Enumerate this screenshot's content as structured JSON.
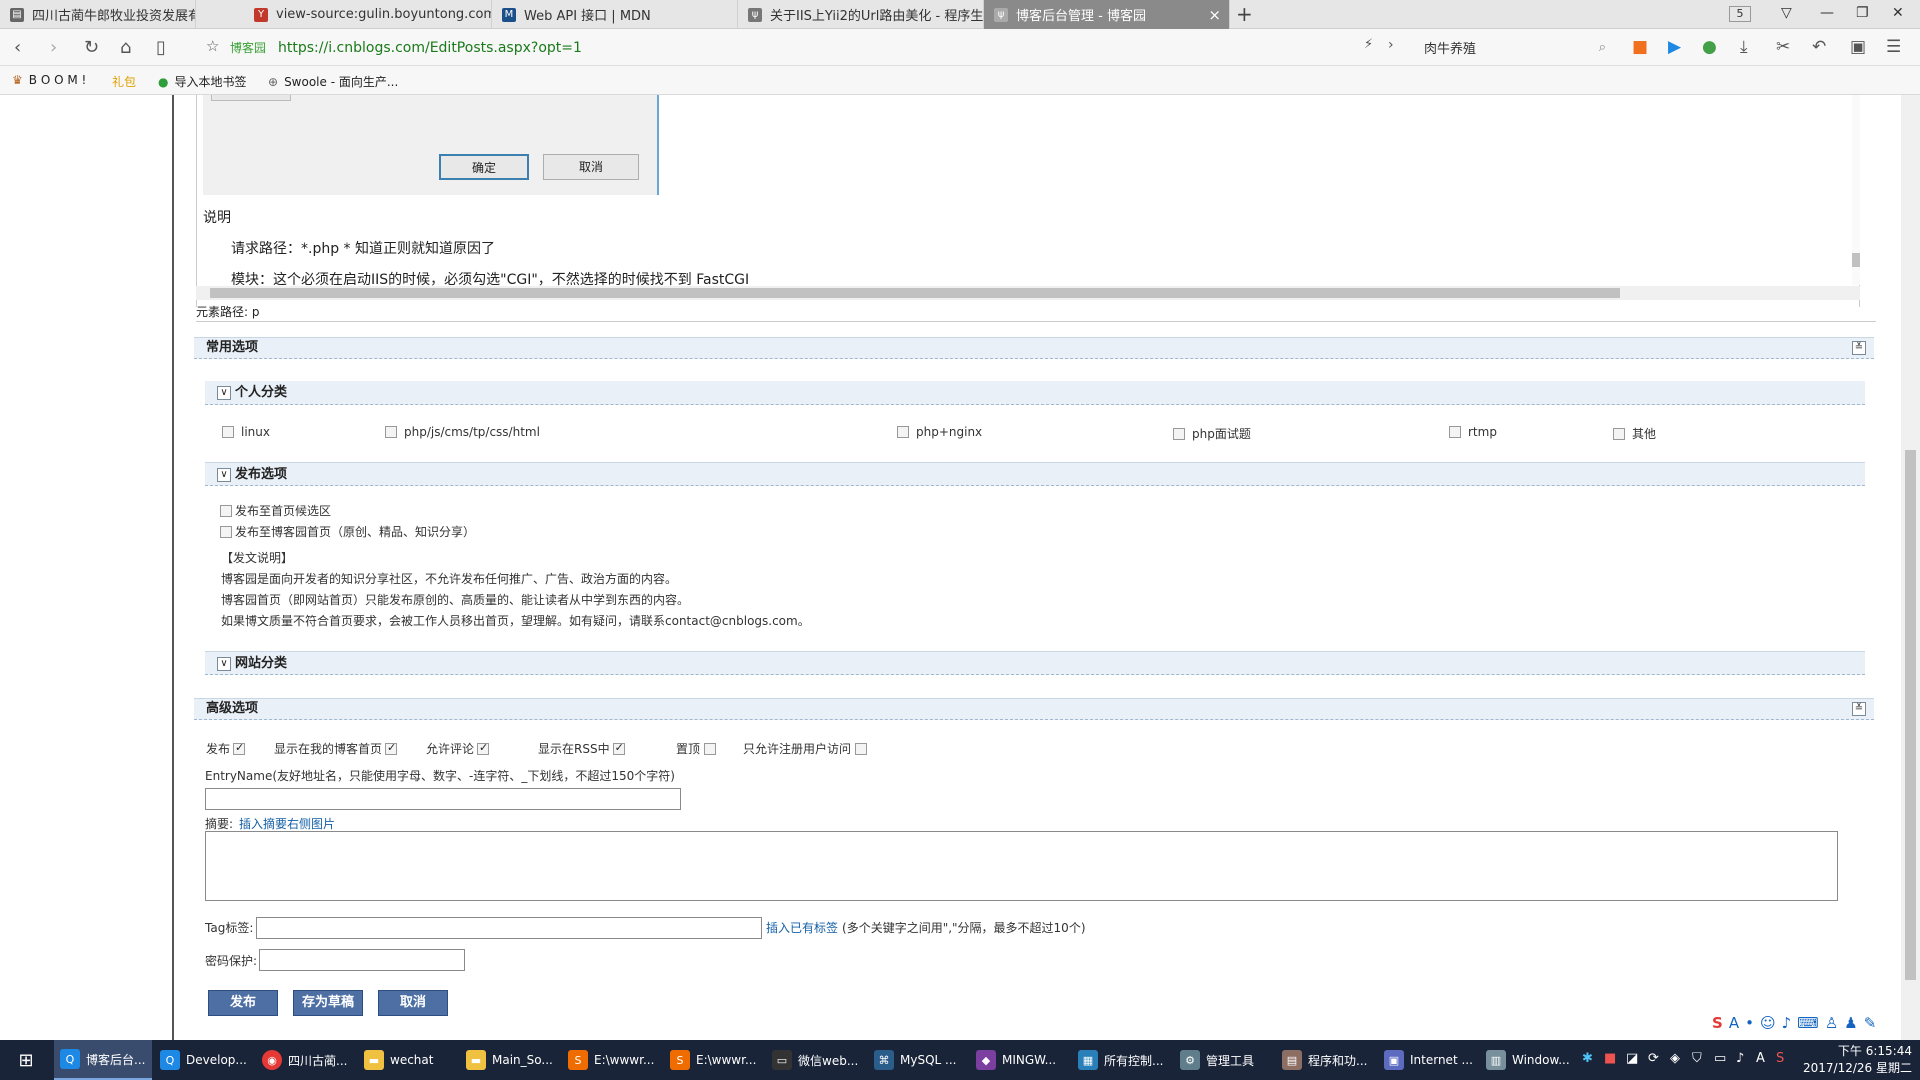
{
  "browser": {
    "tabs": [
      {
        "title": "四川古蔺牛郎牧业投资发展有限公司",
        "active": false
      },
      {
        "title": "view-source:gulin.boyuntong.com",
        "active": false
      },
      {
        "title": "Web API 接口 | MDN",
        "active": false
      },
      {
        "title": "关于IIS上Yii2的Url路由美化 - 程序生",
        "active": false
      },
      {
        "title": "博客后台管理 - 博客园",
        "active": true
      }
    ],
    "new_tab": "+",
    "tab_count": "5",
    "address": {
      "site_label": "博客园",
      "url": "https://i.cnblogs.com/EditPosts.aspx?opt=1"
    },
    "search": "肉牛养殖",
    "bookmarks": [
      "B O O M !",
      "礼包",
      "导入本地书签",
      "Swoole - 面向生产..."
    ]
  },
  "editor": {
    "dialog": {
      "ok": "确定",
      "cancel": "取消"
    },
    "lines": [
      "说明",
      "请求路径：*.php * 知道正则就知道原因了",
      "模块：这个必须在启动IIS的时候，必须勾选\"CGI\"，不然选择的时候找不到 FastCGI"
    ],
    "path": "元素路径: p"
  },
  "common": {
    "title": "常用选项",
    "personal": {
      "title": "个人分类",
      "categories": [
        "linux",
        "php/js/cms/tp/css/html",
        "php+nginx",
        "php面试题",
        "rtmp",
        "其他"
      ]
    },
    "publish": {
      "title": "发布选项",
      "options": [
        "发布至首页候选区",
        "发布至博客园首页（原创、精品、知识分享）"
      ],
      "notes": [
        "【发文说明】",
        "博客园是面向开发者的知识分享社区，不允许发布任何推广、广告、政治方面的内容。",
        "博客园首页（即网站首页）只能发布原创的、高质量的、能让读者从中学到东西的内容。",
        "如果博文质量不符合首页要求，会被工作人员移出首页，望理解。如有疑问，请联系contact@cnblogs.com。"
      ]
    },
    "site_category": {
      "title": "网站分类"
    }
  },
  "advanced": {
    "title": "高级选项",
    "checks": [
      {
        "label": "发布",
        "checked": true
      },
      {
        "label": "显示在我的博客首页",
        "checked": true
      },
      {
        "label": "允许评论",
        "checked": true
      },
      {
        "label": "显示在RSS中",
        "checked": true
      },
      {
        "label": "置顶",
        "checked": false
      },
      {
        "label": "只允许注册用户访问",
        "checked": false
      }
    ],
    "entry_label": "EntryName(友好地址名，只能使用字母、数字、-连字符、_下划线，不超过150个字符)",
    "summary_label": "摘要:",
    "summary_link": "插入摘要右侧图片",
    "tag_label": "Tag标签:",
    "tag_link": "插入已有标签",
    "tag_hint": "(多个关键字之间用\",\"分隔，最多不超过10个)",
    "password_label": "密码保护:",
    "buttons": {
      "publish": "发布",
      "draft": "存为草稿",
      "cancel": "取消"
    }
  },
  "taskbar": {
    "items": [
      "博客后台...",
      "Develop...",
      "四川古蔺...",
      "wechat",
      "Main_So...",
      "E:\\wwwr...",
      "E:\\wwwr...",
      "微信web...",
      "MySQL ...",
      "MINGW...",
      "所有控制...",
      "管理工具",
      "程序和功...",
      "Internet ...",
      "Window..."
    ],
    "time": "下午 6:15:44",
    "date": "2017/12/26 星期二"
  }
}
